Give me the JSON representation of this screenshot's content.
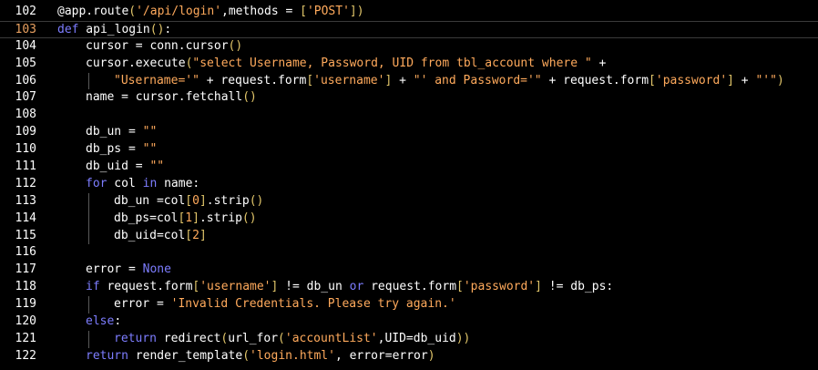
{
  "editor": {
    "current_line": "103",
    "colors": {
      "background": "#000000",
      "text": "#ffffff",
      "string": "#ffaa5c",
      "keyword": "#7d7dff",
      "bracket": "#e2c66a",
      "current_line_number": "#e8a060"
    },
    "lines": [
      {
        "num": "102",
        "indent": 0,
        "tokens": [
          [
            "dec",
            "@app.route"
          ],
          [
            "br",
            "("
          ],
          [
            "str",
            "'/api/login'"
          ],
          [
            "plain",
            ",methods = "
          ],
          [
            "br",
            "["
          ],
          [
            "str",
            "'POST'"
          ],
          [
            "br",
            "])"
          ]
        ]
      },
      {
        "num": "103",
        "indent": 0,
        "current": true,
        "tokens": [
          [
            "kw",
            "def"
          ],
          [
            "plain",
            " api_login"
          ],
          [
            "br",
            "()"
          ],
          [
            "plain",
            ":"
          ]
        ]
      },
      {
        "num": "104",
        "indent": 1,
        "tokens": [
          [
            "plain",
            "cursor = conn.cursor"
          ],
          [
            "br",
            "()"
          ]
        ]
      },
      {
        "num": "105",
        "indent": 1,
        "tokens": [
          [
            "plain",
            "cursor.execute"
          ],
          [
            "br",
            "("
          ],
          [
            "str",
            "\"select Username, Password, UID from tbl_account where \""
          ],
          [
            "plain",
            " +"
          ]
        ]
      },
      {
        "num": "106",
        "indent": 2,
        "tokens": [
          [
            "str",
            "\"Username='\""
          ],
          [
            "plain",
            " + request.form"
          ],
          [
            "br",
            "["
          ],
          [
            "str",
            "'username'"
          ],
          [
            "br",
            "]"
          ],
          [
            "plain",
            " + "
          ],
          [
            "str",
            "\"' and Password='\""
          ],
          [
            "plain",
            " + request.form"
          ],
          [
            "br",
            "["
          ],
          [
            "str",
            "'password'"
          ],
          [
            "br",
            "]"
          ],
          [
            "plain",
            " + "
          ],
          [
            "str",
            "\"'\""
          ],
          [
            "br",
            ")"
          ]
        ]
      },
      {
        "num": "107",
        "indent": 1,
        "tokens": [
          [
            "plain",
            "name = cursor.fetchall"
          ],
          [
            "br",
            "()"
          ]
        ]
      },
      {
        "num": "108",
        "indent": 1,
        "tokens": []
      },
      {
        "num": "109",
        "indent": 1,
        "tokens": [
          [
            "plain",
            "db_un = "
          ],
          [
            "str",
            "\"\""
          ]
        ]
      },
      {
        "num": "110",
        "indent": 1,
        "tokens": [
          [
            "plain",
            "db_ps = "
          ],
          [
            "str",
            "\"\""
          ]
        ]
      },
      {
        "num": "111",
        "indent": 1,
        "tokens": [
          [
            "plain",
            "db_uid = "
          ],
          [
            "str",
            "\"\""
          ]
        ]
      },
      {
        "num": "112",
        "indent": 1,
        "tokens": [
          [
            "kw",
            "for"
          ],
          [
            "plain",
            " col "
          ],
          [
            "kw",
            "in"
          ],
          [
            "plain",
            " name:"
          ]
        ]
      },
      {
        "num": "113",
        "indent": 2,
        "tokens": [
          [
            "plain",
            "db_un =col"
          ],
          [
            "br",
            "["
          ],
          [
            "num",
            "0"
          ],
          [
            "br",
            "]"
          ],
          [
            "plain",
            ".strip"
          ],
          [
            "br",
            "()"
          ]
        ]
      },
      {
        "num": "114",
        "indent": 2,
        "tokens": [
          [
            "plain",
            "db_ps=col"
          ],
          [
            "br",
            "["
          ],
          [
            "num",
            "1"
          ],
          [
            "br",
            "]"
          ],
          [
            "plain",
            ".strip"
          ],
          [
            "br",
            "()"
          ]
        ]
      },
      {
        "num": "115",
        "indent": 2,
        "tokens": [
          [
            "plain",
            "db_uid=col"
          ],
          [
            "br",
            "["
          ],
          [
            "num",
            "2"
          ],
          [
            "br",
            "]"
          ]
        ]
      },
      {
        "num": "116",
        "indent": 1,
        "tokens": []
      },
      {
        "num": "117",
        "indent": 1,
        "tokens": [
          [
            "plain",
            "error = "
          ],
          [
            "kw",
            "None"
          ]
        ]
      },
      {
        "num": "118",
        "indent": 1,
        "tokens": [
          [
            "kw",
            "if"
          ],
          [
            "plain",
            " request.form"
          ],
          [
            "br",
            "["
          ],
          [
            "str",
            "'username'"
          ],
          [
            "br",
            "]"
          ],
          [
            "plain",
            " != db_un "
          ],
          [
            "kw",
            "or"
          ],
          [
            "plain",
            " request.form"
          ],
          [
            "br",
            "["
          ],
          [
            "str",
            "'password'"
          ],
          [
            "br",
            "]"
          ],
          [
            "plain",
            " != db_ps:"
          ]
        ]
      },
      {
        "num": "119",
        "indent": 2,
        "tokens": [
          [
            "plain",
            "error = "
          ],
          [
            "str",
            "'Invalid Credentials. Please try again.'"
          ]
        ]
      },
      {
        "num": "120",
        "indent": 1,
        "tokens": [
          [
            "kw",
            "else"
          ],
          [
            "plain",
            ":"
          ]
        ]
      },
      {
        "num": "121",
        "indent": 2,
        "tokens": [
          [
            "kw",
            "return"
          ],
          [
            "plain",
            " redirect"
          ],
          [
            "br",
            "("
          ],
          [
            "plain",
            "url_for"
          ],
          [
            "br",
            "("
          ],
          [
            "str",
            "'accountList'"
          ],
          [
            "plain",
            ",UID=db_uid"
          ],
          [
            "br",
            "))"
          ]
        ]
      },
      {
        "num": "122",
        "indent": 1,
        "tokens": [
          [
            "kw",
            "return"
          ],
          [
            "plain",
            " render_template"
          ],
          [
            "br",
            "("
          ],
          [
            "str",
            "'login.html'"
          ],
          [
            "plain",
            ", error=error"
          ],
          [
            "br",
            ")"
          ]
        ]
      }
    ]
  }
}
